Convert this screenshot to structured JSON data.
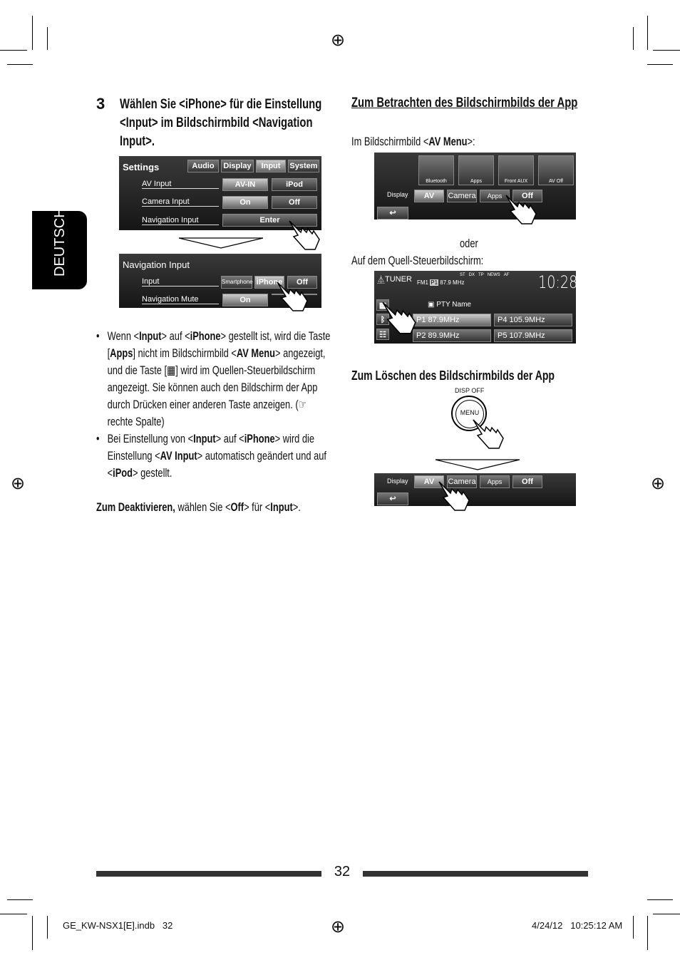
{
  "side_tab": "DEUTSCH",
  "step_number": "3",
  "step_title": "Wählen Sie <iPhone> für die Einstellung <Input> im Bildschirmbild <Navigation Input>.",
  "settings_screen": {
    "title": "Settings",
    "tabs": [
      "Audio",
      "Display",
      "Input",
      "System"
    ],
    "rows": [
      {
        "label": "AV Input",
        "options": [
          "AV-IN",
          "iPod"
        ]
      },
      {
        "label": "Camera Input",
        "options": [
          "On",
          "Off"
        ]
      },
      {
        "label": "Navigation Input",
        "options": [
          "Enter"
        ]
      }
    ]
  },
  "nav_screen": {
    "title": "Navigation Input",
    "rows": [
      {
        "label": "Input",
        "options": [
          "Smartphone",
          "iPhone",
          "Off"
        ]
      },
      {
        "label": "Navigation Mute",
        "options": [
          "On",
          ""
        ]
      }
    ]
  },
  "bullets": [
    [
      {
        "t": "Wenn <"
      },
      {
        "t": "Input",
        "b": 1
      },
      {
        "t": "> auf <"
      },
      {
        "t": "iPhone",
        "b": 1
      },
      {
        "t": "> gestellt ist, wird die Taste ["
      },
      {
        "t": "Apps",
        "b": 1
      },
      {
        "t": "] nicht im Bildschirmbild <"
      },
      {
        "t": "AV Menu",
        "b": 1
      },
      {
        "t": "> angezeigt, und die Taste [▦] wird im Quellen-Steuerbildschirm angezeigt. Sie können auch den Bildschirm der App durch Drücken einer anderen Taste anzeigen. (☞ rechte Spalte)"
      }
    ],
    [
      {
        "t": "Bei Einstellung von <"
      },
      {
        "t": "Input",
        "b": 1
      },
      {
        "t": "> auf <"
      },
      {
        "t": "iPhone",
        "b": 1
      },
      {
        "t": "> wird die Einstellung <"
      },
      {
        "t": "AV Input",
        "b": 1
      },
      {
        "t": "> automatisch geändert und auf <"
      },
      {
        "t": "iPod",
        "b": 1
      },
      {
        "t": "> gestellt."
      }
    ]
  ],
  "deactivate": [
    {
      "t": "Zum Deaktivieren,",
      "b": 1
    },
    {
      "t": " wählen Sie <"
    },
    {
      "t": "Off",
      "b": 1
    },
    {
      "t": "> für <"
    },
    {
      "t": "Input",
      "b": 1
    },
    {
      "t": ">."
    }
  ],
  "right": {
    "heading1": "Zum Betrachten des Bildschirmbilds der App",
    "intro1": [
      {
        "t": "Im Bildschirmbild <"
      },
      {
        "t": "AV Menu",
        "b": 1
      },
      {
        "t": ">:"
      }
    ],
    "av_menu": {
      "tiles": [
        "Bluetooth",
        "Apps",
        "Front AUX",
        "AV Off"
      ],
      "display_label": "Display",
      "buttons": [
        "AV",
        "Camera",
        "Apps",
        "Off"
      ]
    },
    "or": "oder",
    "intro2": "Auf dem Quell-Steuerbildschirm:",
    "tuner": {
      "source": "TUNER",
      "band": "FM1",
      "preset_freq": "87.9 MHz",
      "indicators": [
        "ST",
        "DX",
        "TP",
        "NEWS",
        "AF"
      ],
      "clock": "10:28",
      "pty": "PTY Name",
      "presets": [
        "87.9MHz",
        "105.9MHz",
        "89.9MHz",
        "107.9MHz"
      ],
      "preset_numbers": [
        "P1",
        "P4",
        "P2",
        "P5"
      ]
    },
    "heading2": "Zum Löschen des Bildschirmbilds der App",
    "disp_off": "DISP OFF",
    "menu_button": "MENU",
    "av_bar": {
      "display_label": "Display",
      "buttons": [
        "AV",
        "Camera",
        "Apps",
        "Off"
      ]
    }
  },
  "page_number": "32",
  "footer_left": "GE_KW-NSX1[E].indb   32",
  "footer_right": "4/24/12   10:25:12 AM"
}
